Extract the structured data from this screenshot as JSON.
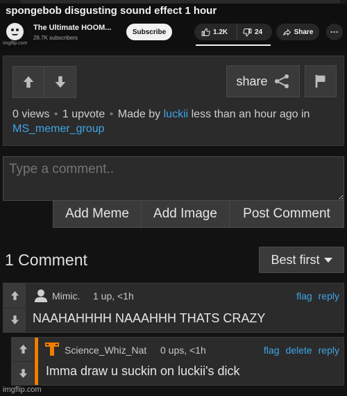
{
  "youtube": {
    "video_title": "spongebob disgusting sound effect 1 hour",
    "channel_name": "The Ultimate HOOM...",
    "subscribers": "26.7K subscribers",
    "subscribe_label": "Subscribe",
    "likes": "1.2K",
    "dislikes": "24",
    "share_label": "Share",
    "more_label": "···",
    "watermark": "imgflip.com"
  },
  "post": {
    "share_label": "share",
    "views": "0 views",
    "upvotes": "1 upvote",
    "made_by_prefix": "Made by",
    "author": "luckii",
    "time_text": "less than an hour ago in",
    "stream": "MS_memer_group",
    "separator": "•"
  },
  "comment_box": {
    "placeholder": "Type a comment.."
  },
  "actions": {
    "add_meme": "Add Meme",
    "add_image": "Add Image",
    "post_comment": "Post Comment"
  },
  "comments_header": {
    "count_label": "1 Comment",
    "sort_label": "Best first"
  },
  "comments": [
    {
      "username": "Mimic.",
      "points": "1 up, <1h",
      "text": "NAAHAHHHH NAAAHHH THATS CRAZY",
      "links": [
        "flag",
        "reply"
      ]
    },
    {
      "username": "Science_Whiz_Nat",
      "points": "0 ups, <1h",
      "text": "Imma draw u suckin on luckii's dick",
      "links": [
        "flag",
        "delete",
        "reply"
      ]
    }
  ],
  "footer": {
    "watermark": "imgflip.com"
  },
  "colors": {
    "background": "#121212",
    "panel": "#2b2b2b",
    "button": "#3a3a3a",
    "link": "#3ea6e8",
    "reply_stripe": "#f07d00"
  }
}
